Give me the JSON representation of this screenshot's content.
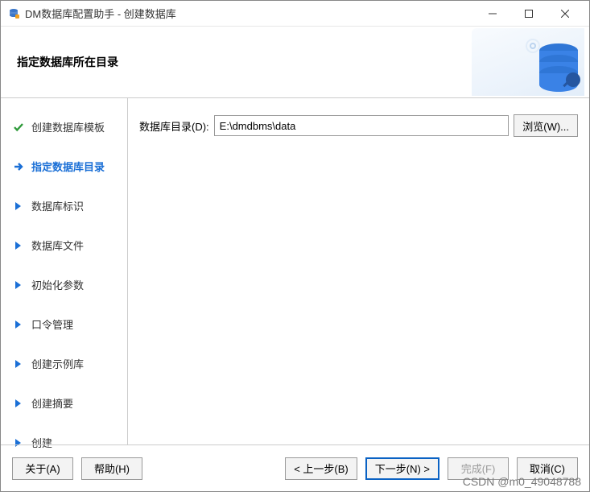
{
  "window": {
    "title": "DM数据库配置助手 - 创建数据库"
  },
  "header": {
    "heading": "指定数据库所在目录"
  },
  "sidebar": {
    "steps": [
      {
        "label": "创建数据库模板",
        "state": "done"
      },
      {
        "label": "指定数据库目录",
        "state": "current"
      },
      {
        "label": "数据库标识",
        "state": "pending"
      },
      {
        "label": "数据库文件",
        "state": "pending"
      },
      {
        "label": "初始化参数",
        "state": "pending"
      },
      {
        "label": "口令管理",
        "state": "pending"
      },
      {
        "label": "创建示例库",
        "state": "pending"
      },
      {
        "label": "创建摘要",
        "state": "pending"
      },
      {
        "label": "创建",
        "state": "pending"
      }
    ]
  },
  "main": {
    "dir_label": "数据库目录(D):",
    "dir_value": "E:\\dmdbms\\data",
    "browse_label": "浏览(W)..."
  },
  "footer": {
    "about": "关于(A)",
    "help": "帮助(H)",
    "back": "< 上一步(B)",
    "next": "下一步(N) >",
    "finish": "完成(F)",
    "cancel": "取消(C)"
  },
  "watermark": "CSDN @m0_49048788"
}
